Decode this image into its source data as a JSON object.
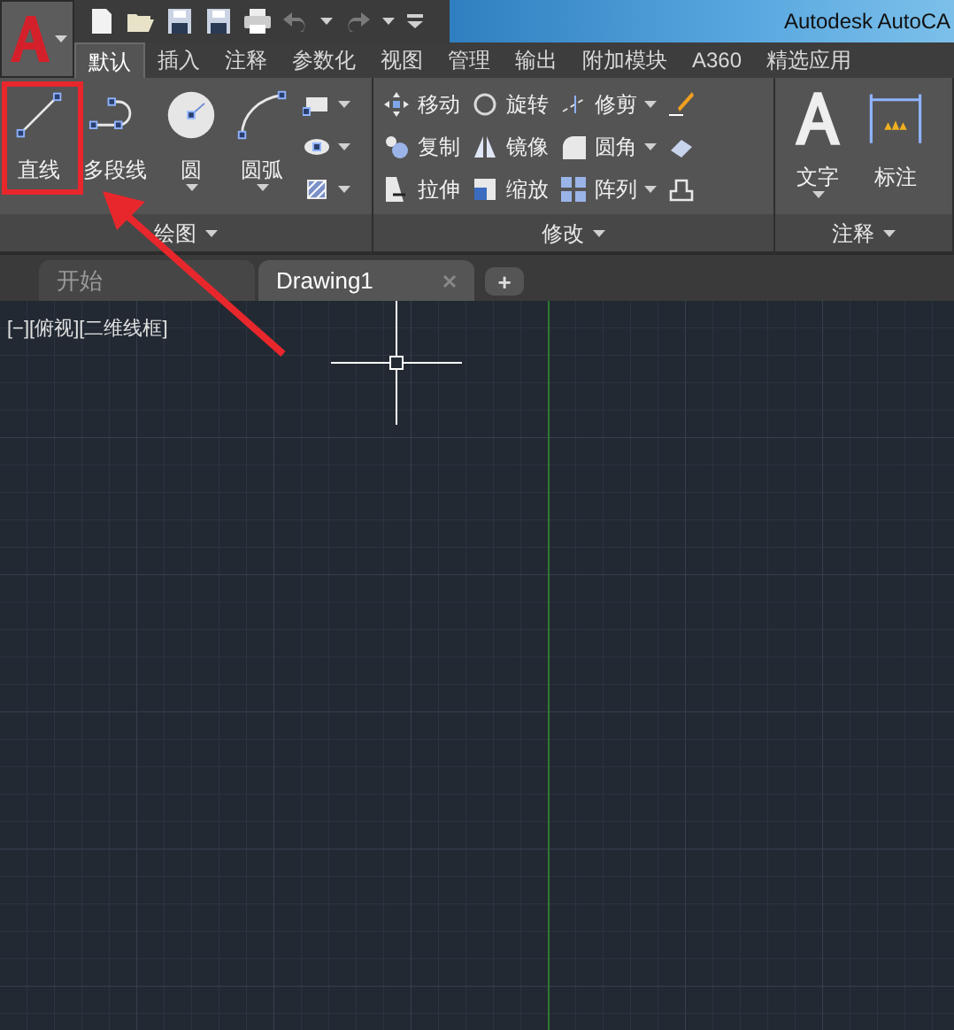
{
  "window": {
    "title": "Autodesk AutoCA"
  },
  "ribbon_tabs": [
    {
      "label": "默认",
      "selected": true
    },
    {
      "label": "插入",
      "selected": false
    },
    {
      "label": "注释",
      "selected": false
    },
    {
      "label": "参数化",
      "selected": false
    },
    {
      "label": "视图",
      "selected": false
    },
    {
      "label": "管理",
      "selected": false
    },
    {
      "label": "输出",
      "selected": false
    },
    {
      "label": "附加模块",
      "selected": false
    },
    {
      "label": "A360",
      "selected": false
    },
    {
      "label": "精选应用",
      "selected": false
    }
  ],
  "panels": [
    {
      "title": "绘图",
      "groups": [
        {
          "kind": "large",
          "label": "直线",
          "dropdown": false
        },
        {
          "kind": "large",
          "label": "多段线",
          "dropdown": false
        },
        {
          "kind": "large",
          "label": "圆",
          "dropdown": true
        },
        {
          "kind": "large",
          "label": "圆弧",
          "dropdown": true
        },
        {
          "kind": "stack",
          "items": [
            {
              "dropdown": true
            },
            {
              "dropdown": true
            },
            {
              "dropdown": true
            }
          ]
        }
      ]
    },
    {
      "title": "修改",
      "groups": [
        {
          "kind": "stack",
          "items": [
            {
              "label": "移动",
              "dropdown": false
            },
            {
              "label": "复制",
              "dropdown": false
            },
            {
              "label": "拉伸",
              "dropdown": false
            }
          ]
        },
        {
          "kind": "stack",
          "items": [
            {
              "label": "旋转",
              "dropdown": false
            },
            {
              "label": "镜像",
              "dropdown": false
            },
            {
              "label": "缩放",
              "dropdown": false
            }
          ]
        },
        {
          "kind": "stack",
          "items": [
            {
              "label": "修剪",
              "dropdown": true
            },
            {
              "label": "圆角",
              "dropdown": true
            },
            {
              "label": "阵列",
              "dropdown": true
            }
          ]
        },
        {
          "kind": "stack",
          "items": [
            {
              "dropdown": false
            },
            {
              "dropdown": false
            },
            {
              "dropdown": false
            }
          ]
        }
      ]
    },
    {
      "title": "注释",
      "groups": [
        {
          "kind": "large",
          "label": "文字",
          "dropdown": true
        },
        {
          "kind": "large",
          "label": "标注",
          "dropdown": false
        }
      ]
    }
  ],
  "doc_tabs": [
    {
      "label": "开始",
      "selected": false,
      "closable": false
    },
    {
      "label": "Drawing1",
      "selected": true,
      "closable": true
    }
  ],
  "new_tab": {
    "label": "+"
  },
  "viewport": {
    "label": "[−][俯视][二维线框]"
  }
}
